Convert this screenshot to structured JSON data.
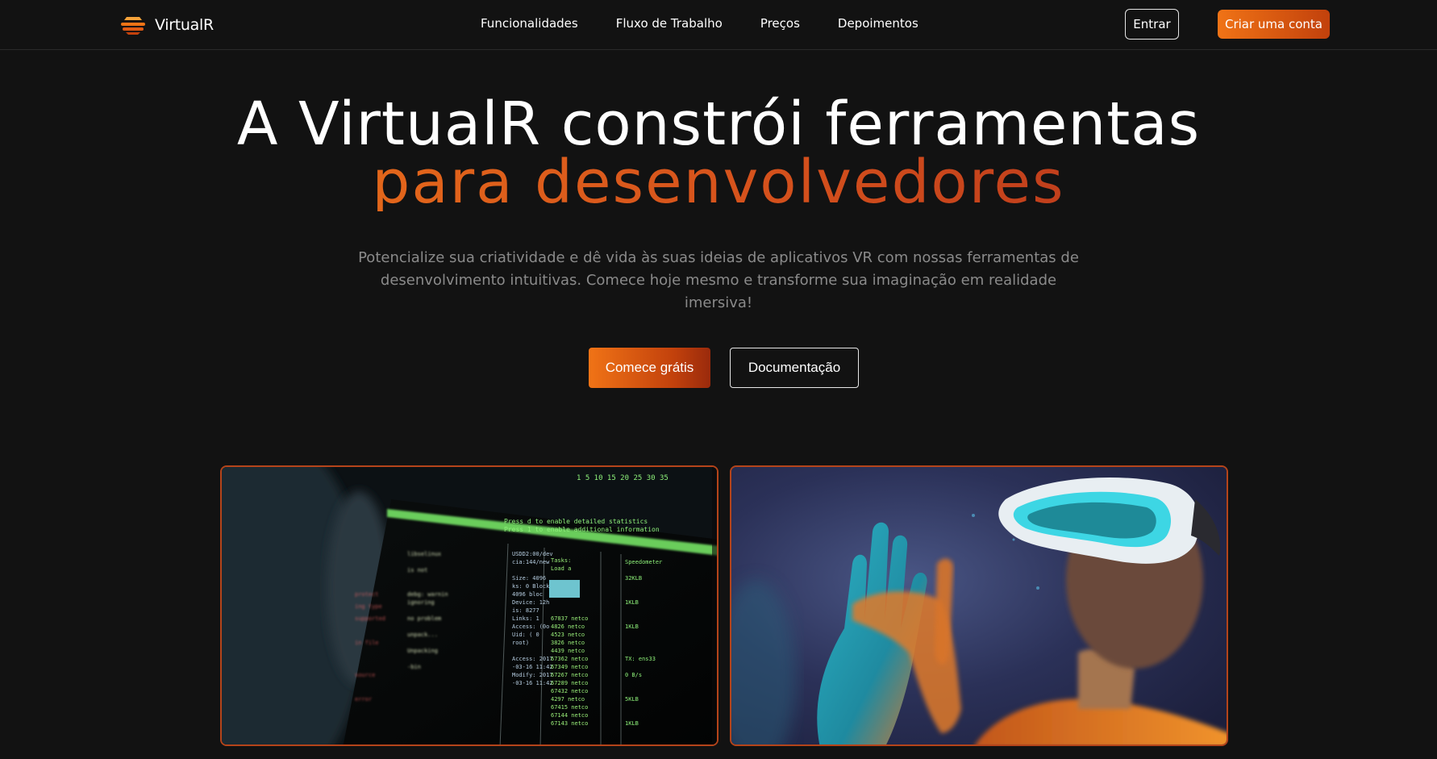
{
  "brand": {
    "name": "VirtualR"
  },
  "nav": {
    "links": [
      "Funcionalidades",
      "Fluxo de Trabalho",
      "Preços",
      "Depoimentos"
    ],
    "login_label": "Entrar",
    "signup_label": "Criar uma conta"
  },
  "hero": {
    "title_line1": "A VirtualR constrói ferramentas",
    "title_line2": "para desenvolvedores",
    "subtitle": "Potencialize sua criatividade e dê vida às suas ideias de aplicativos VR com nossas ferramentas de desenvolvimento intuitivas. Comece hoje mesmo e transforme sua imaginação em realidade imersiva!",
    "start_label": "Comece grátis",
    "docs_label": "Documentação"
  },
  "colors": {
    "accent": "#f07316",
    "accent_dark": "#c2410c",
    "background": "#121212"
  },
  "icons": {
    "brand": "stacked-bars-logo-icon"
  }
}
